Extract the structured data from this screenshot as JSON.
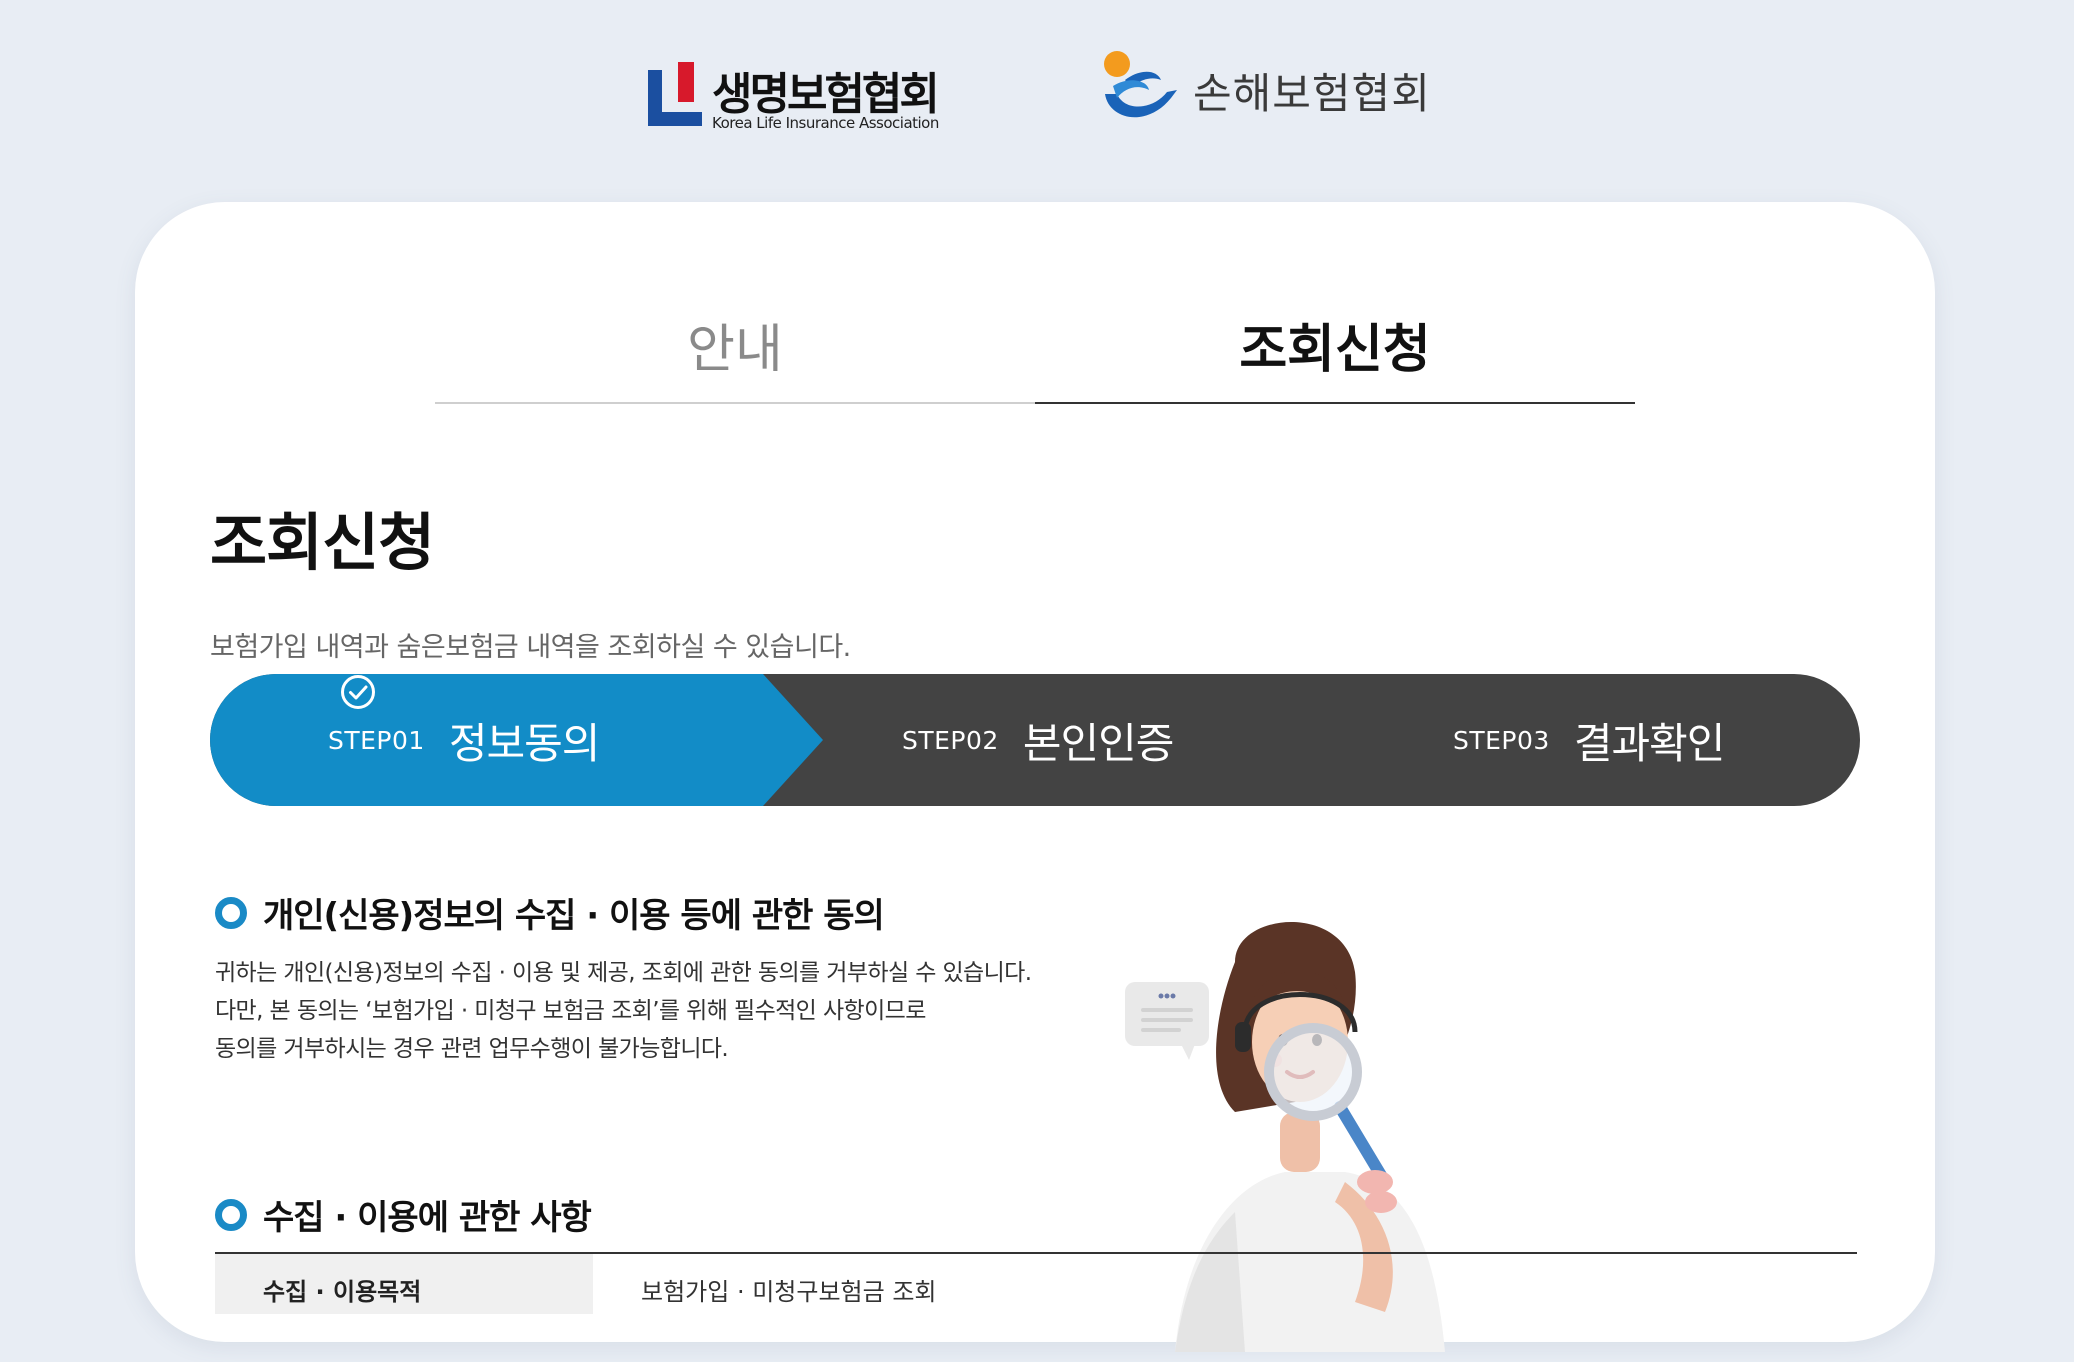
{
  "header": {
    "klia_name": "생명보험협회",
    "klia_sub": "Korea Life Insurance Association",
    "gia_name": "손해보험협회"
  },
  "tabs": [
    {
      "label": "안내",
      "active": false
    },
    {
      "label": "조회신청",
      "active": true
    }
  ],
  "main": {
    "title": "조회신청",
    "description": "보험가입 내역과 숨은보험금 내역을 조회하실 수 있습니다."
  },
  "steps": [
    {
      "num": "STEP01",
      "label": "정보동의",
      "active": true
    },
    {
      "num": "STEP02",
      "label": "본인인증",
      "active": false
    },
    {
      "num": "STEP03",
      "label": "결과확인",
      "active": false
    }
  ],
  "consent": {
    "heading": "개인(신용)정보의 수집 · 이용 등에 관한 동의",
    "lines": [
      "귀하는 개인(신용)정보의 수집 · 이용 및 제공, 조회에 관한 동의를 거부하실 수 있습니다.",
      "다만, 본 동의는 ‘보험가입 · 미청구 보험금 조회’를 위해 필수적인 사항이므로",
      "동의를 거부하시는 경우 관련 업무수행이 불가능합니다."
    ]
  },
  "collection": {
    "heading": "수집 · 이용에 관한 사항",
    "rows": [
      {
        "th": "수집 · 이용목적",
        "td": "보험가입 · 미청구보험금 조회"
      }
    ]
  },
  "colors": {
    "accent": "#1a8ac6",
    "step_active": "#128cc7",
    "step_inactive": "#434343",
    "background": "#e8edf4"
  }
}
